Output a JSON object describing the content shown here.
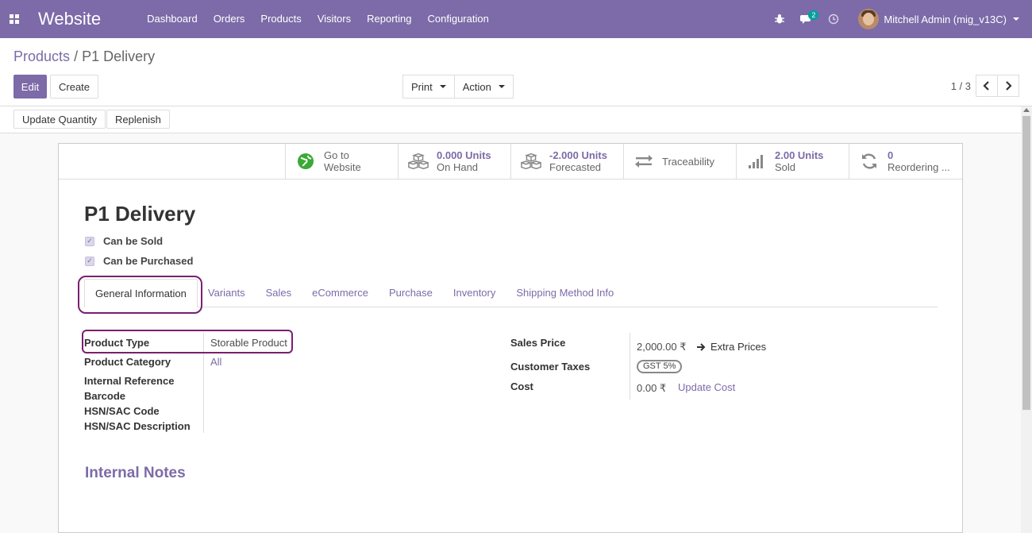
{
  "nav": {
    "brand": "Website",
    "menu": [
      "Dashboard",
      "Orders",
      "Products",
      "Visitors",
      "Reporting",
      "Configuration"
    ],
    "message_count": "2",
    "user": "Mitchell Admin (mig_v13C)"
  },
  "control": {
    "breadcrumb_parent": "Products",
    "breadcrumb_sep": "/",
    "breadcrumb_current": "P1 Delivery",
    "edit": "Edit",
    "create": "Create",
    "print": "Print",
    "action": "Action",
    "pager": "1 / 3"
  },
  "statusbar": {
    "update_qty": "Update Quantity",
    "replenish": "Replenish"
  },
  "smart_buttons": [
    {
      "icon": "globe-icon",
      "value": "Go to",
      "label": "Website"
    },
    {
      "icon": "cubes-icon",
      "value": "0.000 Units",
      "label": "On Hand"
    },
    {
      "icon": "cubes-icon",
      "value": "-2.000 Units",
      "label": "Forecasted"
    },
    {
      "icon": "exchange-icon",
      "value": "",
      "label": "Traceability"
    },
    {
      "icon": "bar-chart-icon",
      "value": "2.00 Units",
      "label": "Sold"
    },
    {
      "icon": "refresh-icon",
      "value": "0",
      "label": "Reordering ..."
    }
  ],
  "product": {
    "name": "P1 Delivery",
    "can_be_sold": "Can be Sold",
    "can_be_purchased": "Can be Purchased"
  },
  "tabs": [
    "General Information",
    "Variants",
    "Sales",
    "eCommerce",
    "Purchase",
    "Inventory",
    "Shipping Method Info"
  ],
  "fields": {
    "product_type_label": "Product Type",
    "product_type_value": "Storable Product",
    "category_label": "Product Category",
    "category_value": "All",
    "internal_ref_label": "Internal Reference",
    "barcode_label": "Barcode",
    "hsn_code_label": "HSN/SAC Code",
    "hsn_desc_label": "HSN/SAC Description",
    "sales_price_label": "Sales Price",
    "sales_price_value": "2,000.00 ₹",
    "extra_prices": "Extra Prices",
    "customer_taxes_label": "Customer Taxes",
    "customer_taxes_value": "GST 5%",
    "cost_label": "Cost",
    "cost_value": "0.00 ₹",
    "update_cost": "Update Cost"
  },
  "internal_notes": "Internal Notes",
  "colors": {
    "primary": "#7c6ba8",
    "highlight": "#7a1f6f"
  }
}
